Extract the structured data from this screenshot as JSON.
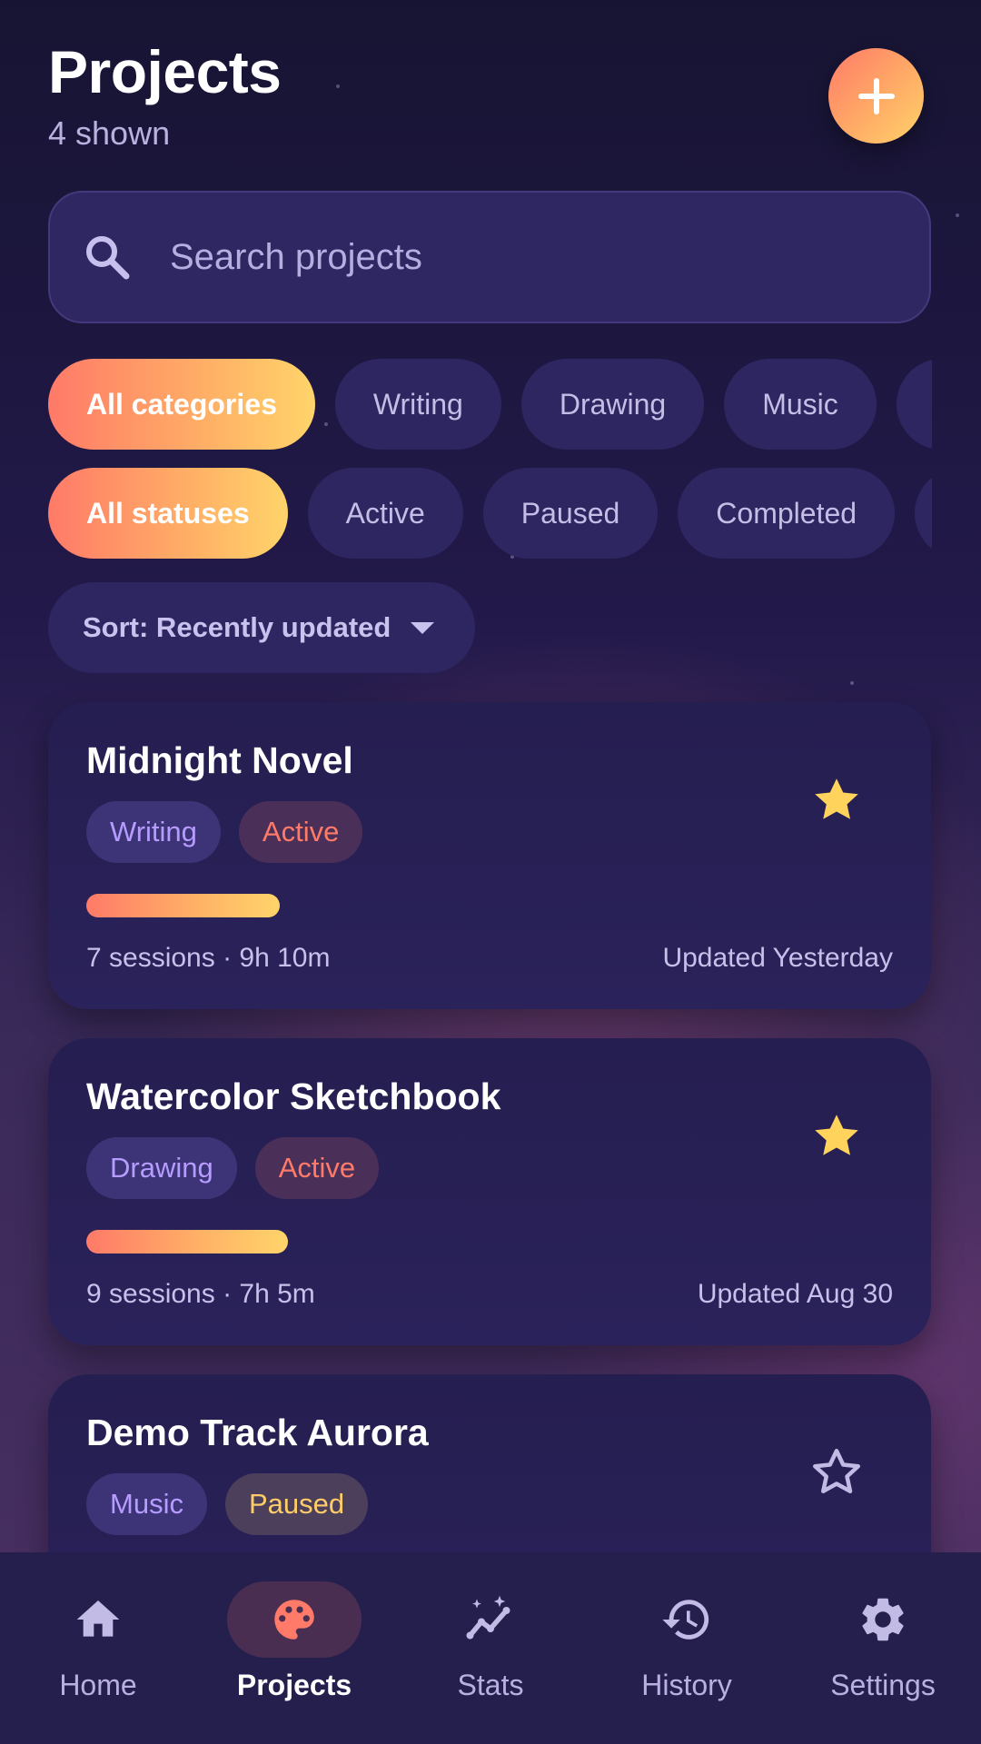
{
  "header": {
    "title": "Projects",
    "subtitle": "4 shown",
    "add_icon": "plus-icon"
  },
  "search": {
    "placeholder": "Search projects",
    "value": "",
    "icon": "search-icon"
  },
  "category_filters": [
    "All categories",
    "Writing",
    "Drawing",
    "Music"
  ],
  "status_filters": [
    "All statuses",
    "Active",
    "Paused",
    "Completed"
  ],
  "sort": {
    "label": "Sort: Recently updated",
    "icon": "caret-down-icon"
  },
  "projects": [
    {
      "title": "Midnight Novel",
      "category": "Writing",
      "status": "Active",
      "status_kind": "active",
      "progress": 0.24,
      "meta": "7 sessions · 9h 10m",
      "updated": "Updated Yesterday",
      "favorite": true
    },
    {
      "title": "Watercolor Sketchbook",
      "category": "Drawing",
      "status": "Active",
      "status_kind": "active",
      "progress": 0.25,
      "meta": "9 sessions · 7h 5m",
      "updated": "Updated Aug 30",
      "favorite": true
    },
    {
      "title": "Demo Track Aurora",
      "category": "Music",
      "status": "Paused",
      "status_kind": "paused",
      "progress": 0.0,
      "meta": "",
      "updated": "",
      "favorite": false
    }
  ],
  "nav": [
    {
      "label": "Home",
      "icon": "home-icon",
      "selected": false
    },
    {
      "label": "Projects",
      "icon": "palette-icon",
      "selected": true
    },
    {
      "label": "Stats",
      "icon": "chart-sparkle-icon",
      "selected": false
    },
    {
      "label": "History",
      "icon": "history-icon",
      "selected": false
    },
    {
      "label": "Settings",
      "icon": "gear-icon",
      "selected": false
    }
  ],
  "colors": {
    "accent_start": "#ff7a68",
    "accent_end": "#ffd46a",
    "star": "#ffd35c",
    "card": "#271f55"
  }
}
